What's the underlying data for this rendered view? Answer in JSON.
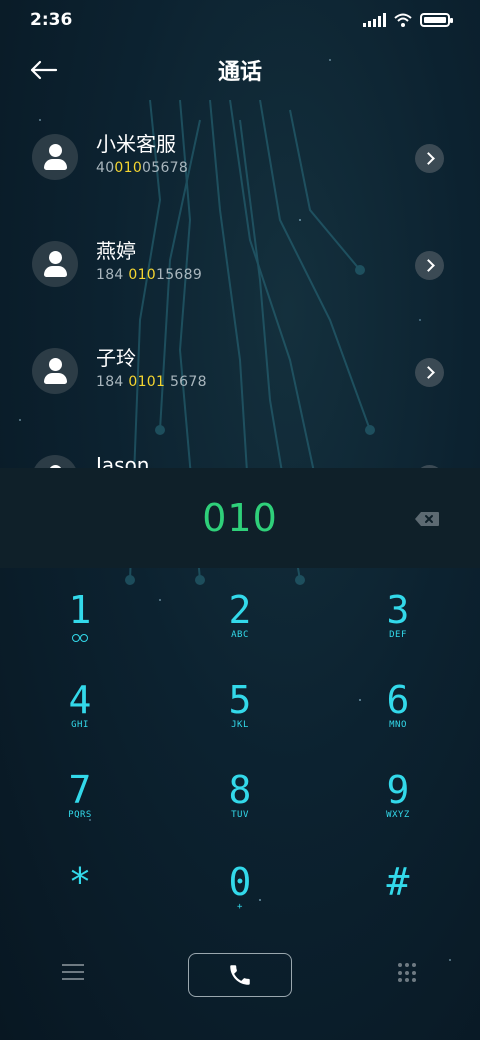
{
  "status_bar": {
    "time": "2:36"
  },
  "header": {
    "title": "通话"
  },
  "contacts": [
    {
      "name": "小米客服",
      "number_parts": [
        "40",
        "010",
        "05678"
      ]
    },
    {
      "name": "燕婷",
      "number_parts": [
        "184 ",
        "010",
        "15689"
      ]
    },
    {
      "name": "子玲",
      "number_parts": [
        "184 ",
        "0101",
        " 5678"
      ]
    },
    {
      "name": "Jason",
      "number_parts": [
        "",
        "",
        ""
      ]
    }
  ],
  "dialer": {
    "dialed_number": "010"
  },
  "keypad": [
    {
      "digit": "1",
      "letters": ""
    },
    {
      "digit": "2",
      "letters": "ABC"
    },
    {
      "digit": "3",
      "letters": "DEF"
    },
    {
      "digit": "4",
      "letters": "GHI"
    },
    {
      "digit": "5",
      "letters": "JKL"
    },
    {
      "digit": "6",
      "letters": "MNO"
    },
    {
      "digit": "7",
      "letters": "PQRS"
    },
    {
      "digit": "8",
      "letters": "TUV"
    },
    {
      "digit": "9",
      "letters": "WXYZ"
    },
    {
      "digit": "*",
      "letters": ""
    },
    {
      "digit": "0",
      "letters": "+"
    },
    {
      "digit": "#",
      "letters": ""
    }
  ],
  "colors": {
    "accent_digits": "#33d9ea",
    "dialed_text": "#2fd07a",
    "highlight": "#f5d630"
  },
  "icons": {
    "back": "arrow-left-icon",
    "delete": "backspace-icon",
    "call": "phone-icon",
    "menu": "list-icon",
    "keypad": "dialpad-icon",
    "voicemail": "voicemail-icon"
  }
}
